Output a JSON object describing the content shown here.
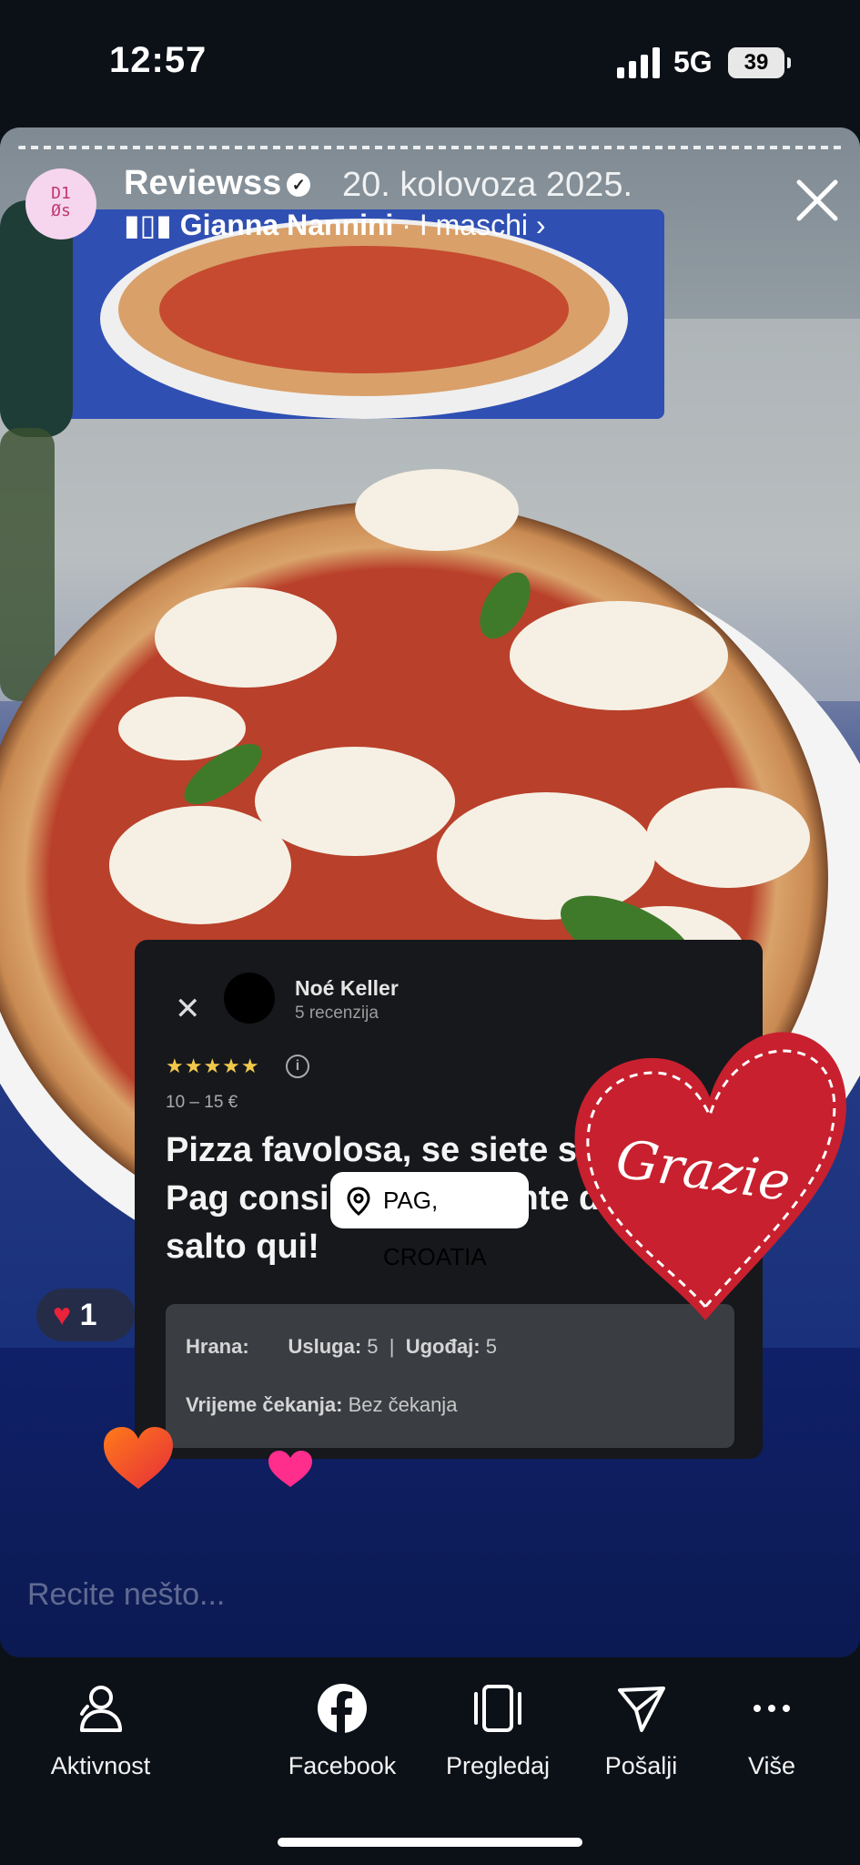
{
  "status": {
    "time": "12:57",
    "network": "5G",
    "battery": "39"
  },
  "story": {
    "account_name": "Reviewss",
    "avatar_text": "D1\nØs",
    "date": "20. kolovoza 2025.",
    "music_artist": "Gianna Nannini",
    "music_song": "· I maschi",
    "likes_count": "1",
    "reply_placeholder": "Recite nešto..."
  },
  "review": {
    "reviewer_name": "Noé Keller",
    "reviewer_count": "5 recenzija",
    "stars": "★★★★★",
    "info_glyph": "i",
    "price": "10 – 15 €",
    "text": "Pizza favolosa, se siete sull’isola di Pag consiglio vivamente di fare un salto qui!",
    "food_label": "Hrana:",
    "service_label": "Usluga:",
    "service_value": "5",
    "separator": "|",
    "ambience_label": "Ugođaj:",
    "ambience_value": "5",
    "wait_label": "Vrijeme čekanja:",
    "wait_value": "Bez čekanja"
  },
  "stickers": {
    "location": "PAG, CROATIA",
    "heart_text": "Grazie"
  },
  "bottom_nav": {
    "activity": "Aktivnost",
    "facebook": "Facebook",
    "preview": "Pregledaj",
    "send": "Pošalji",
    "more": "Više"
  },
  "colors": {
    "heart_red": "#c8202e",
    "star": "#f2c84b",
    "background": "#0c1118"
  }
}
